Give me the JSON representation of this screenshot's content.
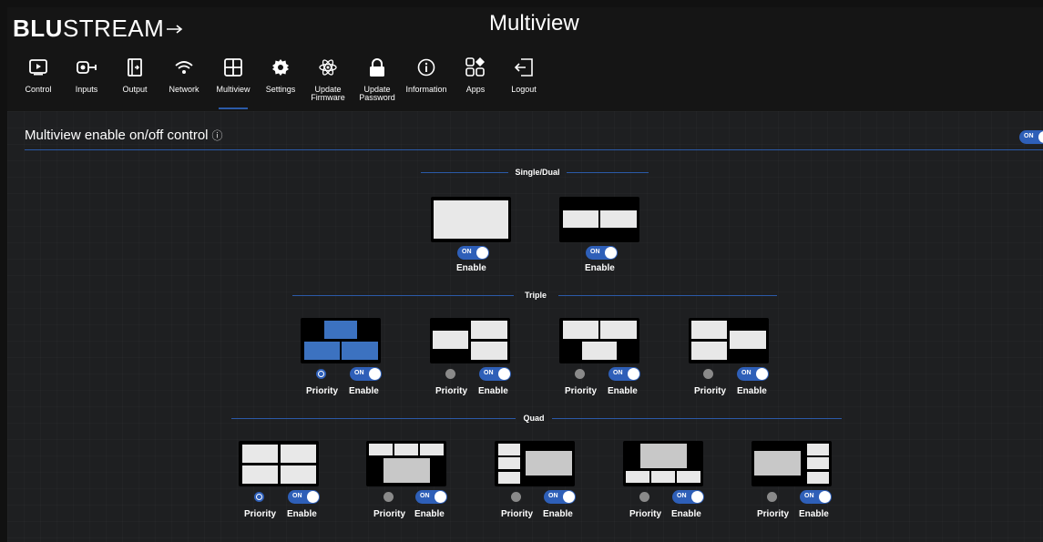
{
  "app": {
    "logo_bold": "BLU",
    "logo_thin": "STREAM",
    "page_title": "Multiview"
  },
  "nav": [
    {
      "label": "Control",
      "icon": "play-icon"
    },
    {
      "label": "Inputs",
      "icon": "input-icon"
    },
    {
      "label": "Output",
      "icon": "output-icon"
    },
    {
      "label": "Network",
      "icon": "wifi-icon"
    },
    {
      "label": "Multiview",
      "icon": "grid-icon",
      "active": true
    },
    {
      "label": "Settings",
      "icon": "gear-icon"
    },
    {
      "label": "Update\nFirmware",
      "icon": "atom-icon"
    },
    {
      "label": "Update\nPassword",
      "icon": "lock-icon"
    },
    {
      "label": "Information",
      "icon": "info-icon"
    },
    {
      "label": "Apps",
      "icon": "apps-icon"
    },
    {
      "label": "Logout",
      "icon": "logout-icon"
    }
  ],
  "multiview": {
    "heading": "Multiview enable on/off control",
    "info_glyph": "ⓘ",
    "master_toggle": "ON"
  },
  "sections": {
    "single_dual": "Single/Dual",
    "triple": "Triple",
    "quad": "Quad"
  },
  "controls": {
    "toggle_on": "ON",
    "enable": "Enable",
    "priority": "Priority"
  },
  "colors": {
    "accent": "#2e5fb8",
    "pane": "#e8e8e8",
    "pane_priority": "#3c72c0",
    "background": "#1e1f21"
  }
}
